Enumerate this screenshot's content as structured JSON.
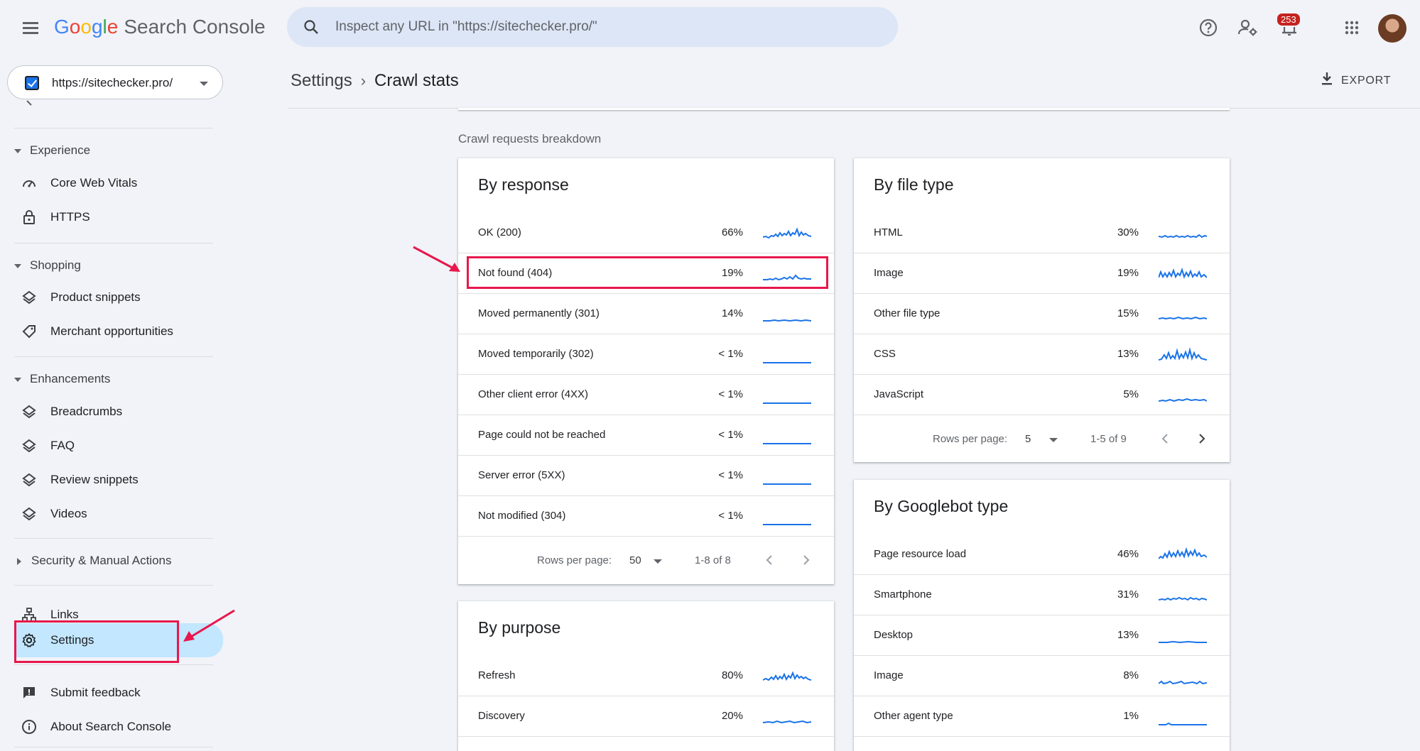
{
  "app": {
    "logo_google": [
      "G",
      "o",
      "o",
      "g",
      "l",
      "e"
    ],
    "product": "Search Console",
    "search_placeholder": "Inspect any URL in \"https://sitechecker.pro/\"",
    "notification_count": "253"
  },
  "property": {
    "url": "https://sitechecker.pro/"
  },
  "sidebar": {
    "sections": [
      {
        "title": "Experience",
        "items": [
          "Core Web Vitals",
          "HTTPS"
        ]
      },
      {
        "title": "Shopping",
        "items": [
          "Product snippets",
          "Merchant opportunities"
        ]
      },
      {
        "title": "Enhancements",
        "items": [
          "Breadcrumbs",
          "FAQ",
          "Review snippets",
          "Videos"
        ]
      },
      {
        "title": "Security & Manual Actions"
      }
    ],
    "links": "Links",
    "settings": "Settings",
    "submit_feedback": "Submit feedback",
    "about": "About Search Console"
  },
  "header": {
    "breadcrumb_parent": "Settings",
    "breadcrumb_sep": "›",
    "breadcrumb_current": "Crawl stats",
    "export_label": "EXPORT"
  },
  "main": {
    "section_title": "Crawl requests breakdown",
    "by_response": {
      "title": "By response",
      "rows": [
        {
          "name": "OK (200)",
          "pct": "66%"
        },
        {
          "name": "Not found (404)",
          "pct": "19%"
        },
        {
          "name": "Moved permanently (301)",
          "pct": "14%"
        },
        {
          "name": "Moved temporarily (302)",
          "pct": "< 1%"
        },
        {
          "name": "Other client error (4XX)",
          "pct": "< 1%"
        },
        {
          "name": "Page could not be reached",
          "pct": "< 1%"
        },
        {
          "name": "Server error (5XX)",
          "pct": "< 1%"
        },
        {
          "name": "Not modified (304)",
          "pct": "< 1%"
        }
      ],
      "pager": {
        "label": "Rows per page:",
        "value": "50",
        "range": "1-8 of 8"
      }
    },
    "by_file_type": {
      "title": "By file type",
      "rows": [
        {
          "name": "HTML",
          "pct": "30%"
        },
        {
          "name": "Image",
          "pct": "19%"
        },
        {
          "name": "Other file type",
          "pct": "15%"
        },
        {
          "name": "CSS",
          "pct": "13%"
        },
        {
          "name": "JavaScript",
          "pct": "5%"
        }
      ],
      "pager": {
        "label": "Rows per page:",
        "value": "5",
        "range": "1-5 of 9"
      }
    },
    "by_purpose": {
      "title": "By purpose",
      "rows": [
        {
          "name": "Refresh",
          "pct": "80%"
        },
        {
          "name": "Discovery",
          "pct": "20%"
        }
      ]
    },
    "by_googlebot_type": {
      "title": "By Googlebot type",
      "rows": [
        {
          "name": "Page resource load",
          "pct": "46%"
        },
        {
          "name": "Smartphone",
          "pct": "31%"
        },
        {
          "name": "Desktop",
          "pct": "13%"
        },
        {
          "name": "Image",
          "pct": "8%"
        },
        {
          "name": "Other agent type",
          "pct": "1%"
        }
      ]
    }
  },
  "colors": {
    "accent": "#1a73e8",
    "annotation": "#e8174c",
    "active_nav": "#c2e7ff"
  }
}
